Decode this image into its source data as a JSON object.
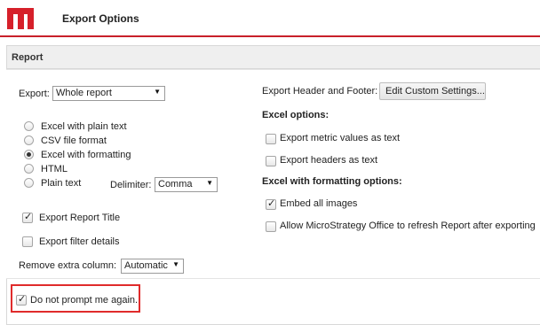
{
  "header": {
    "title": "Export Options",
    "logo": "microstrategy-logo",
    "accent_color": "#d6202a"
  },
  "section": {
    "title": "Report"
  },
  "export": {
    "label": "Export:",
    "value": "Whole report",
    "formats": [
      {
        "label": "Excel with plain text",
        "selected": false
      },
      {
        "label": "CSV file format",
        "selected": false
      },
      {
        "label": "Excel with formatting",
        "selected": true
      },
      {
        "label": "HTML",
        "selected": false
      },
      {
        "label": "Plain text",
        "selected": false
      }
    ],
    "delimiter_label": "Delimiter:",
    "delimiter_value": "Comma"
  },
  "left_options": [
    {
      "label": "Export Report Title",
      "checked": true
    },
    {
      "label": "Export filter details",
      "checked": false
    }
  ],
  "remove_column": {
    "label": "Remove extra column:",
    "value": "Automatic"
  },
  "right": {
    "header_footer_label": "Export Header and Footer:",
    "edit_button": "Edit Custom Settings...",
    "excel_options_title": "Excel options:",
    "excel_options": [
      {
        "label": "Export metric values as text",
        "checked": false
      },
      {
        "label": "Export headers as text",
        "checked": false
      }
    ],
    "formatting_title": "Excel with formatting options:",
    "formatting_options": [
      {
        "label": "Embed all images",
        "checked": true
      },
      {
        "label": "Allow MicroStrategy Office to refresh Report after exporting",
        "checked": false
      }
    ]
  },
  "footer": {
    "prompt_label": "Do not prompt me again.",
    "prompt_checked": true
  }
}
